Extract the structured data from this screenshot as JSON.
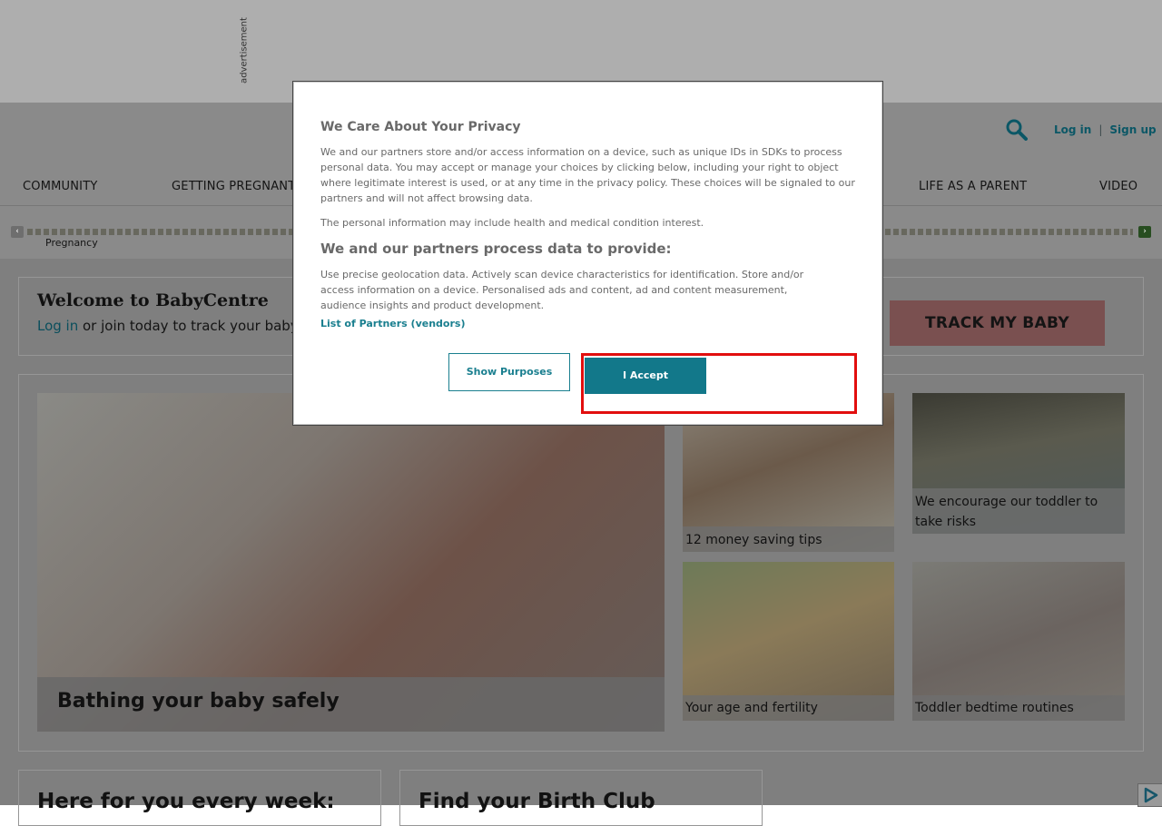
{
  "ad": {
    "label": "advertisement"
  },
  "header": {
    "search_icon": "search-icon",
    "login": "Log in",
    "separator": "|",
    "signup": "Sign up",
    "nav": [
      "COMMUNITY",
      "GETTING PREGNANT",
      "LIFE AS A PARENT",
      "VIDEO"
    ]
  },
  "timeline": {
    "label": "Pregnancy",
    "prev_icon": "chevron-left-icon",
    "next_icon": "chevron-right-icon",
    "prev_glyph": "‹",
    "next_glyph": "›"
  },
  "welcome": {
    "title": "Welcome to BabyCentre",
    "login_link": "Log in",
    "text": " or join today to track your baby",
    "button": "TRACK MY BABY"
  },
  "features": {
    "hero_caption": "Bathing your baby safely",
    "cards": [
      {
        "caption": "12 money saving tips"
      },
      {
        "caption": "We encourage our toddler to take risks"
      },
      {
        "caption": "Your age and fertility"
      },
      {
        "caption": "Toddler bedtime routines"
      }
    ]
  },
  "bottom": {
    "left_title": "Here for you every week:",
    "right_title": "Find your Birth Club"
  },
  "consent": {
    "title": "We Care About Your Privacy",
    "paragraph1": "We and our partners store and/or access information on a device, such as unique IDs in SDKs to process personal data. You may accept or manage your choices by clicking below, including your right to object where legitimate interest is used, or at any time in the privacy policy. These choices will be signaled to our partners and will not affect browsing data.",
    "paragraph2": "The personal information may include health and medical condition interest.",
    "heading": "We and our partners process data to provide:",
    "paragraph3": "Use precise geolocation data. Actively scan device characteristics for identification. Store and/or access information on a device. Personalised ads and content, ad and content measurement, audience insights and product development.",
    "partners_link": "List of Partners (vendors)",
    "show_purposes": "Show Purposes",
    "accept": "I Accept"
  },
  "colors": {
    "accent": "#12788a",
    "link": "#1a7f8f",
    "highlight": "#e20e0e",
    "overlay": "#7f7f7f"
  }
}
